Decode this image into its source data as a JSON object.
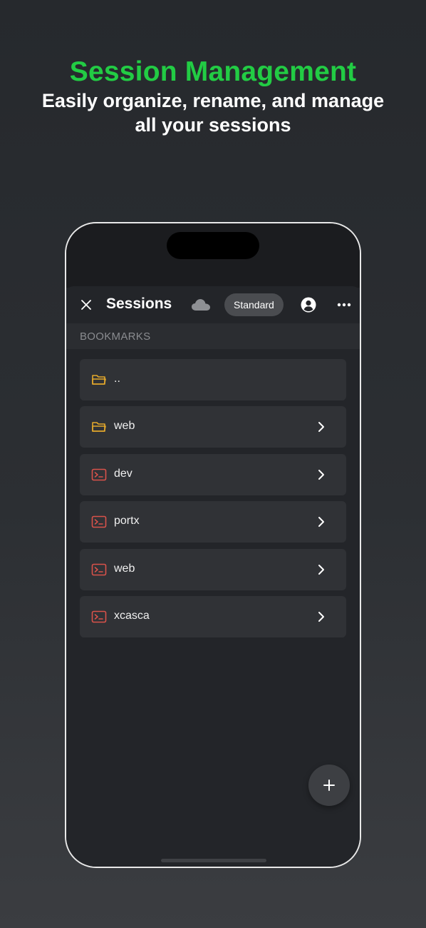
{
  "promo": {
    "title": "Session Management",
    "subtitle_line1": "Easily organize, rename, and manage",
    "subtitle_line2": "all your sessions"
  },
  "header": {
    "title": "Sessions",
    "mode_label": "Standard"
  },
  "section": {
    "label": "BOOKMARKS"
  },
  "items": [
    {
      "label": "..",
      "icon": "folder-icon",
      "has_chevron": false
    },
    {
      "label": "web",
      "icon": "folder-icon",
      "has_chevron": true
    },
    {
      "label": "dev",
      "icon": "terminal-icon",
      "has_chevron": true
    },
    {
      "label": "portx",
      "icon": "terminal-icon",
      "has_chevron": true
    },
    {
      "label": "web",
      "icon": "terminal-icon",
      "has_chevron": true
    },
    {
      "label": "xcasca",
      "icon": "terminal-icon",
      "has_chevron": true
    }
  ],
  "colors": {
    "accent_green": "#22cc44",
    "folder_yellow": "#e3a82b",
    "terminal_red": "#d9524a"
  }
}
